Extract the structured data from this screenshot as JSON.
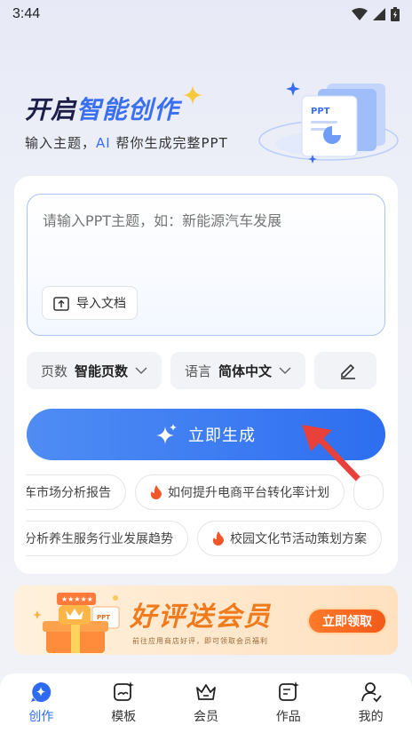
{
  "status_bar": {
    "time": "3:44"
  },
  "hero": {
    "title_part1": "开启",
    "title_part2": "智能创作",
    "subtitle_before": "输入主题，",
    "subtitle_ai": "AI",
    "subtitle_after": " 帮你生成完整PPT",
    "illustration_label": "PPT"
  },
  "input": {
    "placeholder": "请输入PPT主题，如：新能源汽车发展",
    "import_label": "导入文档"
  },
  "options": [
    {
      "label": "页数",
      "value": "智能页数"
    },
    {
      "label": "语言",
      "value": "简体中文"
    }
  ],
  "generate_button": {
    "label": "立即生成"
  },
  "suggestions": {
    "row1": [
      "车市场分析报告",
      "如何提升电商平台转化率计划"
    ],
    "row2": [
      "分析养生服务行业发展趋势",
      "校园文化节活动策划方案"
    ]
  },
  "banner": {
    "title": "好评送会员",
    "subtitle": "前往应用商店好评，即可领取会员福利",
    "button": "立即领取",
    "art_label": "PPT"
  },
  "tabs": [
    {
      "label": "创作",
      "icon": "create-icon",
      "active": true
    },
    {
      "label": "模板",
      "icon": "template-icon",
      "active": false
    },
    {
      "label": "会员",
      "icon": "crown-icon",
      "active": false
    },
    {
      "label": "作品",
      "icon": "works-icon",
      "active": false
    },
    {
      "label": "我的",
      "icon": "profile-icon",
      "active": false
    }
  ],
  "colors": {
    "accent": "#3d7cf2",
    "fire": "#f2572a",
    "banner_orange": "#f07a1c",
    "annotation_arrow": "#e8403a"
  }
}
